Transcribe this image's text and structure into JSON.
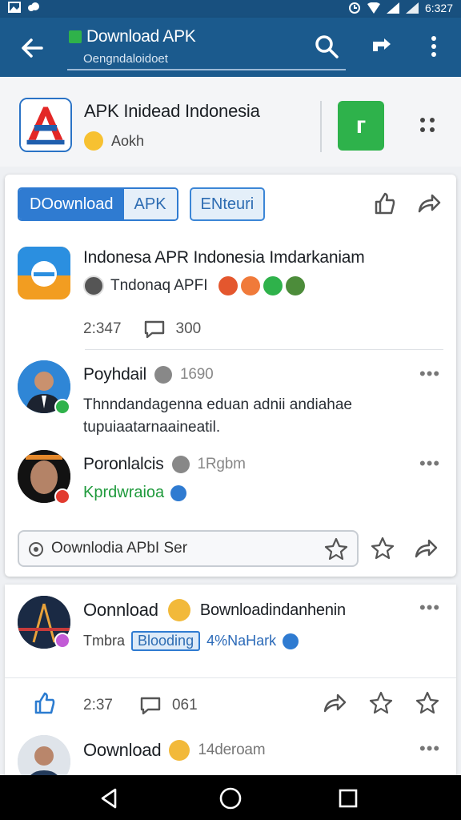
{
  "status_bar": {
    "time": "6:327"
  },
  "app_bar": {
    "title": "Download APK",
    "subtitle": "Oengndaloidoet"
  },
  "app_header": {
    "name": "APK Inidead Indonesia",
    "subtitle": "Aokh",
    "green_badge": "г"
  },
  "tabs": {
    "download_label": "DOownload",
    "apk_label": "APK",
    "third_label": "ENteuri"
  },
  "posts": [
    {
      "title": "Indonesa APR Indonesia Imdarkaniam",
      "subtitle": "Tndonaq APFI",
      "count1": "2:347",
      "count2": "300"
    },
    {
      "title": "Poyhdail",
      "meta": "1690",
      "body": "Thnndandagenna eduan adnii andiahae tupuiaatarnaaineatil."
    },
    {
      "title": "Poronlalcis",
      "meta": "1Rgbm",
      "body": "Kprdwraioa"
    }
  ],
  "search_bar": {
    "placeholder": "Oownlodia APbI Ser"
  },
  "feed": [
    {
      "title": "Oonnload",
      "headline": "Bownloadindanhenin",
      "meta1": "Tmbra",
      "tag": "Blooding",
      "meta2": "4%NaHark",
      "count1": "2:37",
      "count2": "061"
    },
    {
      "title": "Oownload",
      "meta": "14deroam"
    }
  ],
  "colors": {
    "app_bar": "#1b5a8d",
    "accent_blue": "#2f7bd1",
    "green": "#2eb24b"
  }
}
